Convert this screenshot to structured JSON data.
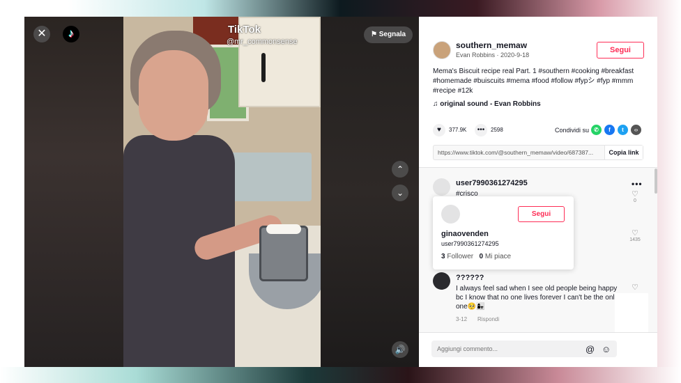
{
  "video": {
    "watermark_brand": "TikTok",
    "watermark_user": "@mr_commonsense",
    "report_label": "Segnala",
    "close_icon": "close-icon",
    "up_icon": "chevron-up-icon",
    "down_icon": "chevron-down-icon",
    "volume_icon": "volume-icon"
  },
  "post": {
    "username": "southern_memaw",
    "author_name": "Evan Robbins",
    "date": "2020-9-18",
    "follow_label": "Segui",
    "description": "Mema's Biscuit recipe real Part. 1 #southern #cooking #breakfast #homemade #buiscuits #mema #food #follow #fypシ #fyp #mmm #recipe #12k",
    "sound": "original sound - Evan Robbins",
    "likes": "377.9K",
    "comments": "2598",
    "share_label": "Condividi su",
    "share_icons": [
      "whatsapp-icon",
      "facebook-icon",
      "twitter-icon",
      "embed-icon"
    ],
    "link": "https://www.tiktok.com/@southern_memaw/video/687387...",
    "copy_label": "Copia link"
  },
  "comments": [
    {
      "user": "user7990361274295",
      "text": "#crisco",
      "likes": "0"
    },
    {
      "user": "",
      "text": "",
      "likes": "1435"
    },
    {
      "user": "??????",
      "text": "I always feel sad when I see old people being happy bc I know that no one lives forever I can't be the onl one🥺👩‍👧",
      "date": "3-12",
      "reply_label": "Rispondi"
    }
  ],
  "popup": {
    "name": "ginaovenden",
    "id": "user7990361274295",
    "follow_label": "Segui",
    "followers_count": "3",
    "followers_label": "Follower",
    "likes_count": "0",
    "likes_label": "Mi piace"
  },
  "add_comment": {
    "placeholder": "Aggiungi commento...",
    "mention_icon": "at-icon",
    "emoji_icon": "emoji-icon"
  },
  "colors": {
    "accent": "#fe2c55",
    "whatsapp": "#25d366",
    "facebook": "#1877f2",
    "twitter": "#1da1f2",
    "embed": "#555555"
  }
}
